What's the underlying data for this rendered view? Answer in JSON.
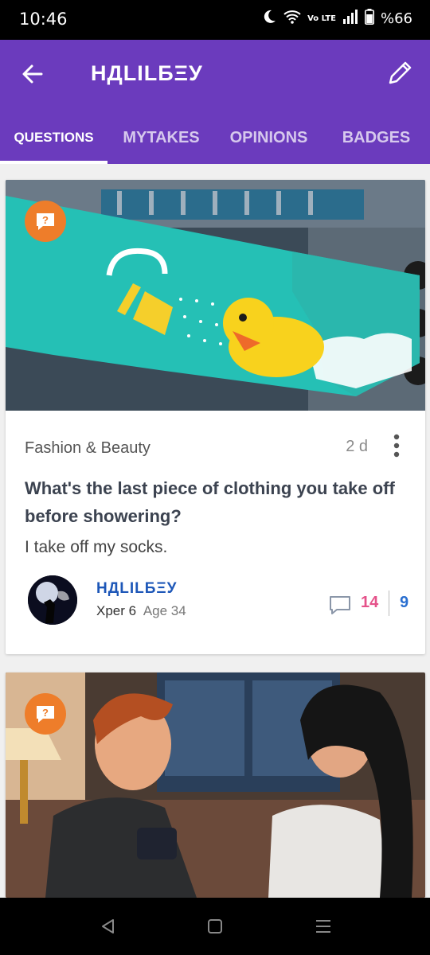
{
  "status": {
    "time": "10:46",
    "battery": "%66",
    "network": "Vo LTE"
  },
  "header": {
    "title": "НДLILБΞУ",
    "back_icon": "arrow-left-icon",
    "edit_icon": "pencil-icon"
  },
  "tabs": [
    {
      "label": "QUESTIONS",
      "active": true
    },
    {
      "label": "MYTAKES",
      "active": false
    },
    {
      "label": "OPINIONS",
      "active": false
    },
    {
      "label": "BADGES",
      "active": false
    }
  ],
  "posts": [
    {
      "category": "Fashion & Beauty",
      "time_ago": "2 d",
      "title": "What's the last piece of clothing you take off before showering?",
      "description": "I take off my socks.",
      "author": {
        "name": "НДLILБΞУ",
        "level": "Xper 6",
        "age": "Age 34"
      },
      "opinions_count": "14",
      "second_count": "9"
    }
  ],
  "colors": {
    "appbar": "#6b3bbd",
    "badge": "#ee7d2a",
    "author": "#1d57b8",
    "pink": "#e5528a",
    "blue": "#2a6fd0"
  }
}
